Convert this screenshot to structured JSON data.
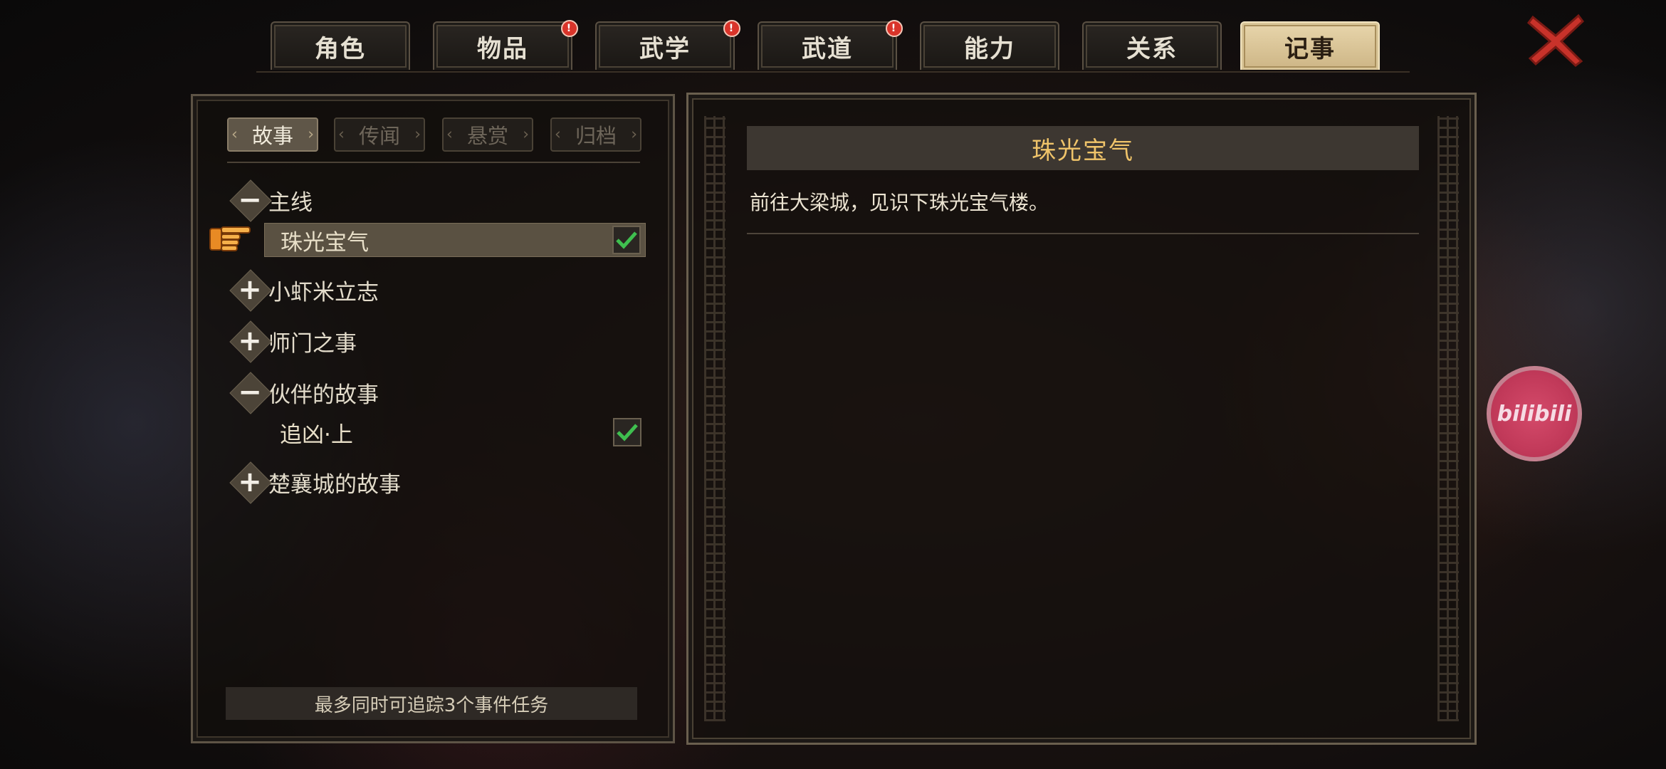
{
  "tabs": [
    {
      "label": "角色",
      "badge": false,
      "active": false
    },
    {
      "label": "物品",
      "badge": true,
      "active": false
    },
    {
      "label": "武学",
      "badge": true,
      "active": false
    },
    {
      "label": "武道",
      "badge": true,
      "active": false
    },
    {
      "label": "能力",
      "badge": false,
      "active": false
    },
    {
      "label": "关系",
      "badge": false,
      "active": false
    },
    {
      "label": "记事",
      "badge": false,
      "active": true
    }
  ],
  "badge_symbol": "!",
  "subtabs": [
    {
      "label": "故事",
      "active": true
    },
    {
      "label": "传闻",
      "active": false
    },
    {
      "label": "悬赏",
      "active": false
    },
    {
      "label": "归档",
      "active": false
    }
  ],
  "categories": [
    {
      "label": "主线",
      "expanded": true,
      "icon": "minus"
    },
    {
      "label": "小虾米立志",
      "expanded": false,
      "icon": "plus"
    },
    {
      "label": "师门之事",
      "expanded": false,
      "icon": "plus"
    },
    {
      "label": "伙伴的故事",
      "expanded": true,
      "icon": "minus"
    },
    {
      "label": "楚襄城的故事",
      "expanded": false,
      "icon": "plus"
    }
  ],
  "quests": [
    {
      "label": "珠光宝气",
      "tracked": true,
      "selected": true
    },
    {
      "label": "追凶·上",
      "tracked": true,
      "selected": false
    }
  ],
  "footer_note": "最多同时可追踪3个事件任务",
  "detail": {
    "title": "珠光宝气",
    "description": "前往大梁城，见识下珠光宝气楼。"
  },
  "floating_button": "bilibili",
  "colors": {
    "active_tab": "#d9c597",
    "title_gold": "#f0c46a",
    "badge_red": "#d9342a",
    "check_green": "#3fbf4f",
    "close_red": "#c8322a"
  }
}
